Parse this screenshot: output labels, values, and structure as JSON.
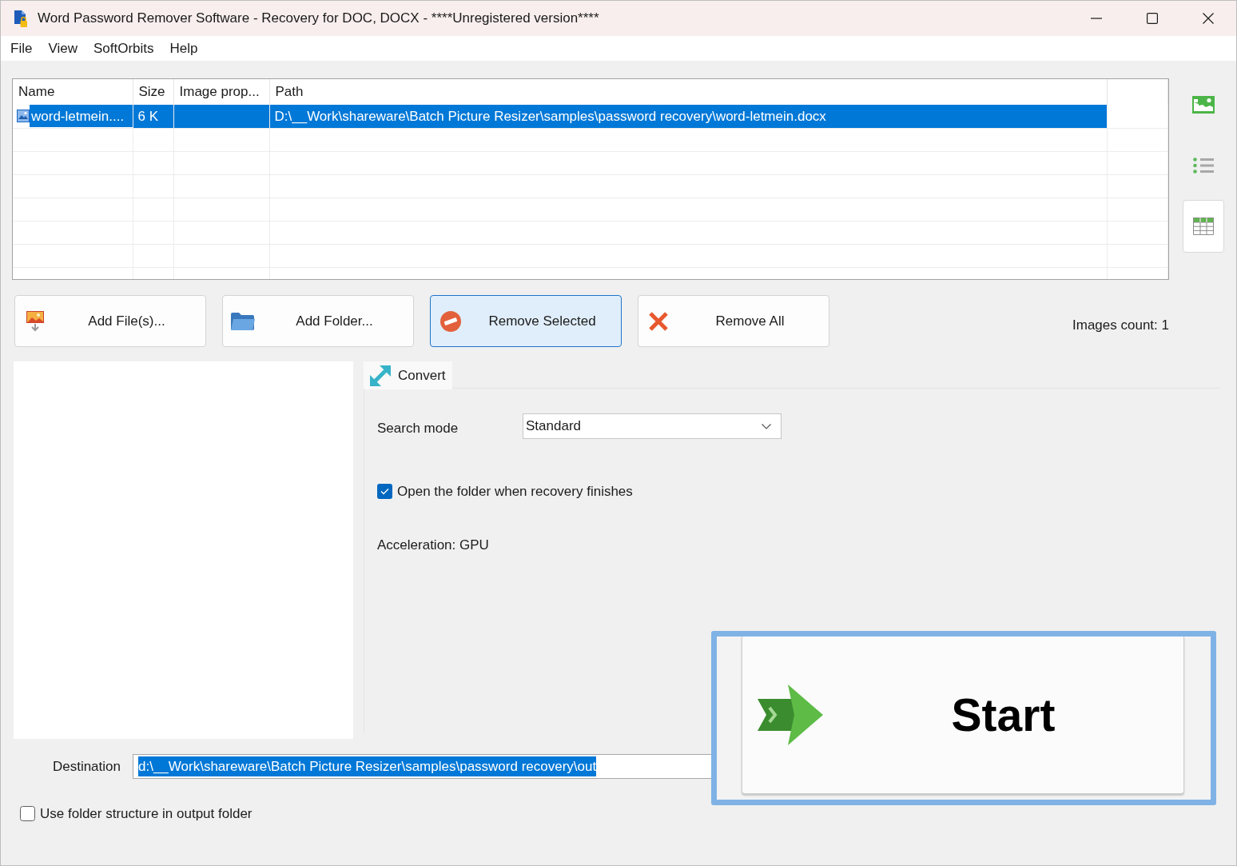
{
  "window": {
    "title": "Word Password Remover Software - Recovery for DOC, DOCX - ****Unregistered version****"
  },
  "menu": [
    {
      "label": "File"
    },
    {
      "label": "View"
    },
    {
      "label": "SoftOrbits"
    },
    {
      "label": "Help"
    }
  ],
  "file_table": {
    "columns": [
      "Name",
      "Size",
      "Image prop...",
      "Path"
    ],
    "rows": [
      {
        "name": "word-letmein....",
        "size": "6 K",
        "path": "D:\\__Work\\shareware\\Batch Picture Resizer\\samples\\password recovery\\word-letmein.docx",
        "selected": true
      }
    ]
  },
  "view_modes": [
    {
      "kind": "thumbnails",
      "selected": false
    },
    {
      "kind": "list",
      "selected": false
    },
    {
      "kind": "details",
      "selected": true
    }
  ],
  "file_buttons": [
    {
      "kind": "add_files",
      "label": "Add File(s)...",
      "highlighted": false
    },
    {
      "kind": "add_folder",
      "label": "Add Folder...",
      "highlighted": false
    },
    {
      "kind": "remove_selected",
      "label": "Remove Selected",
      "highlighted": true
    },
    {
      "kind": "remove_all",
      "label": "Remove All",
      "highlighted": false
    }
  ],
  "images_count": "Images count: 1",
  "tabs": [
    {
      "label": "Convert",
      "selected": true
    }
  ],
  "convert_panel": {
    "search_mode": {
      "label": "Search mode",
      "value": "Standard"
    },
    "open_folder": {
      "label": "Open the folder when recovery finishes",
      "checked": true
    },
    "acceleration": "Acceleration: GPU"
  },
  "destination": {
    "label": "Destination",
    "value": "d:\\__Work\\shareware\\Batch Picture Resizer\\samples\\password recovery\\out",
    "text_selected": true
  },
  "use_folder_structure": {
    "label": "Use folder structure in output folder",
    "checked": false
  },
  "start_button": {
    "label": "Start",
    "focused": true
  }
}
